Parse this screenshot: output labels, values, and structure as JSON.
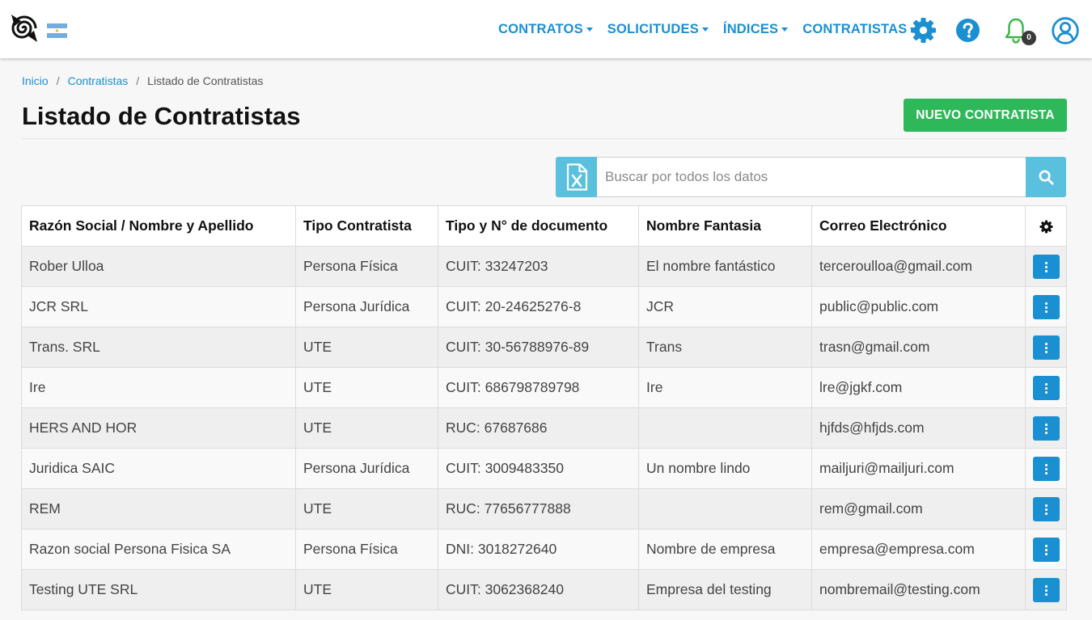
{
  "nav": {
    "menu": [
      {
        "label": "CONTRATOS"
      },
      {
        "label": "SOLICITUDES"
      },
      {
        "label": "ÍNDICES"
      },
      {
        "label": "CONTRATISTAS"
      }
    ],
    "notifications_count": "0"
  },
  "breadcrumb": {
    "home": "Inicio",
    "section": "Contratistas",
    "current": "Listado de Contratistas",
    "separator": "/"
  },
  "page": {
    "title": "Listado de Contratistas",
    "new_button": "NUEVO CONTRATISTA"
  },
  "search": {
    "placeholder": "Buscar por todos los datos",
    "value": ""
  },
  "table": {
    "headers": [
      "Razón Social / Nombre y Apellido",
      "Tipo Contratista",
      "Tipo y N° de documento",
      "Nombre Fantasia",
      "Correo Electrónico"
    ],
    "rows": [
      {
        "name": "Rober Ulloa",
        "type": "Persona Física",
        "doc": "CUIT: 33247203",
        "fantasy": "El nombre fantástico",
        "email": "terceroulloa@gmail.com"
      },
      {
        "name": "JCR SRL",
        "type": "Persona Jurídica",
        "doc": "CUIT: 20-24625276-8",
        "fantasy": "JCR",
        "email": "public@public.com"
      },
      {
        "name": "Trans. SRL",
        "type": "UTE",
        "doc": "CUIT: 30-56788976-89",
        "fantasy": "Trans",
        "email": "trasn@gmail.com"
      },
      {
        "name": "Ire",
        "type": "UTE",
        "doc": "CUIT: 686798789798",
        "fantasy": "Ire",
        "email": "lre@jgkf.com"
      },
      {
        "name": "HERS AND HOR",
        "type": "UTE",
        "doc": "RUC: 67687686",
        "fantasy": "",
        "email": "hjfds@hfjds.com"
      },
      {
        "name": "Juridica SAIC",
        "type": "Persona Jurídica",
        "doc": "CUIT: 3009483350",
        "fantasy": "Un nombre lindo",
        "email": "mailjuri@mailjuri.com"
      },
      {
        "name": "REM",
        "type": "UTE",
        "doc": "RUC: 77656777888",
        "fantasy": "",
        "email": "rem@gmail.com"
      },
      {
        "name": "Razon social Persona Fisica SA",
        "type": "Persona Física",
        "doc": "DNI: 3018272640",
        "fantasy": "Nombre de empresa",
        "email": "empresa@empresa.com"
      },
      {
        "name": "Testing UTE SRL",
        "type": "UTE",
        "doc": "CUIT: 3062368240",
        "fantasy": "Empresa del testing",
        "email": "nombremail@testing.com"
      }
    ]
  },
  "icons": {
    "logo": "spiral-logo-icon",
    "flag": "argentina-flag-icon",
    "settings": "gear-icon",
    "help": "question-circle-icon",
    "notifications": "bell-icon",
    "user": "user-circle-icon",
    "excel": "excel-file-icon",
    "search": "search-icon",
    "row_actions": "vertical-dots-icon"
  },
  "colors": {
    "primary": "#1a8fd1",
    "success": "#2fb85a",
    "info": "#5bc0de",
    "bell": "#3cb54a"
  }
}
